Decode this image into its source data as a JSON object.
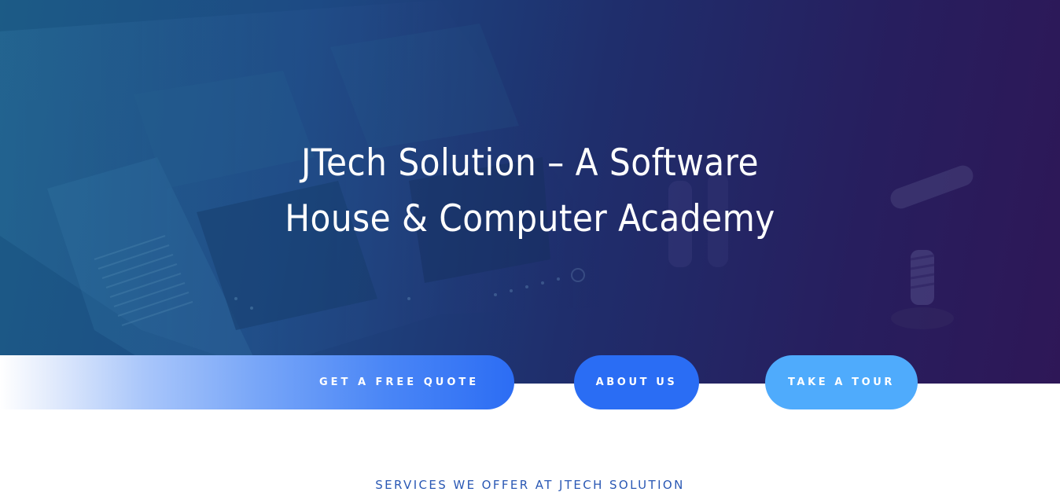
{
  "hero": {
    "title_line_1": "JTech Solution – A Software",
    "title_line_2": "House & Computer Academy",
    "background_image": "circuit-board-photo"
  },
  "cta": {
    "quote_label": "GET A FREE QUOTE",
    "about_label": "ABOUT US",
    "tour_label": "TAKE A TOUR"
  },
  "services": {
    "heading": "SERVICES WE OFFER AT JTECH SOLUTION"
  },
  "colors": {
    "hero_gradient_start": "#1c5b86",
    "hero_gradient_end": "#2e1757",
    "about_button": "#2a6df4",
    "tour_button": "#4fabfc",
    "services_heading": "#2a58b4"
  }
}
